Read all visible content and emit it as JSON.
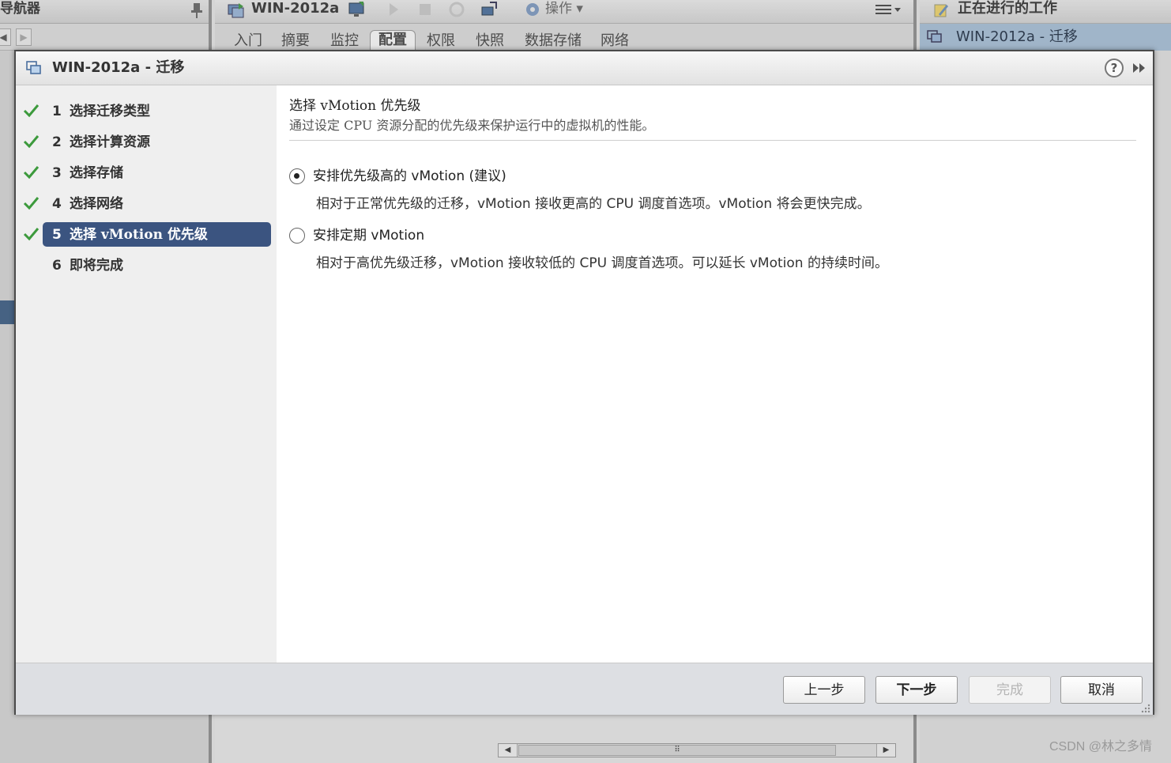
{
  "navigator": {
    "title": "导航器"
  },
  "object": {
    "title": "WIN-2012a",
    "actions_label": "操作",
    "tabs": [
      {
        "label": "入门"
      },
      {
        "label": "摘要"
      },
      {
        "label": "监控"
      },
      {
        "label": "配置"
      },
      {
        "label": "权限"
      },
      {
        "label": "快照"
      },
      {
        "label": "数据存储"
      },
      {
        "label": "网络"
      }
    ]
  },
  "work_in_progress": {
    "title": "正在进行的工作",
    "task": "WIN-2012a - 迁移"
  },
  "dialog": {
    "title": "WIN-2012a - 迁移",
    "help_symbol": "?",
    "steps": [
      {
        "num": "1",
        "label": "选择迁移类型",
        "done": true
      },
      {
        "num": "2",
        "label": "选择计算资源",
        "done": true
      },
      {
        "num": "3",
        "label": "选择存储",
        "done": true
      },
      {
        "num": "4",
        "label": "选择网络",
        "done": true
      },
      {
        "num": "5",
        "label": "选择 vMotion 优先级",
        "done": true,
        "current": true
      },
      {
        "num": "6",
        "label": "即将完成",
        "done": false
      }
    ],
    "section_title": "选择 vMotion 优先级",
    "section_subtitle": "通过设定 CPU 资源分配的优先级来保护运行中的虚拟机的性能。",
    "options": [
      {
        "label": "安排优先级高的 vMotion (建议)",
        "description": "相对于正常优先级的迁移，vMotion 接收更高的 CPU 调度首选项。vMotion 将会更快完成。",
        "selected": true
      },
      {
        "label": "安排定期 vMotion",
        "description": "相对于高优先级迁移，vMotion 接收较低的 CPU 调度首选项。可以延长 vMotion 的持续时间。",
        "selected": false
      }
    ],
    "buttons": {
      "back": "上一步",
      "next": "下一步",
      "finish": "完成",
      "cancel": "取消"
    }
  },
  "watermark": "CSDN @林之多情",
  "colors": {
    "accent": "#3b5480",
    "check": "#3c9a3c",
    "task_highlight": "#a9c3db"
  }
}
